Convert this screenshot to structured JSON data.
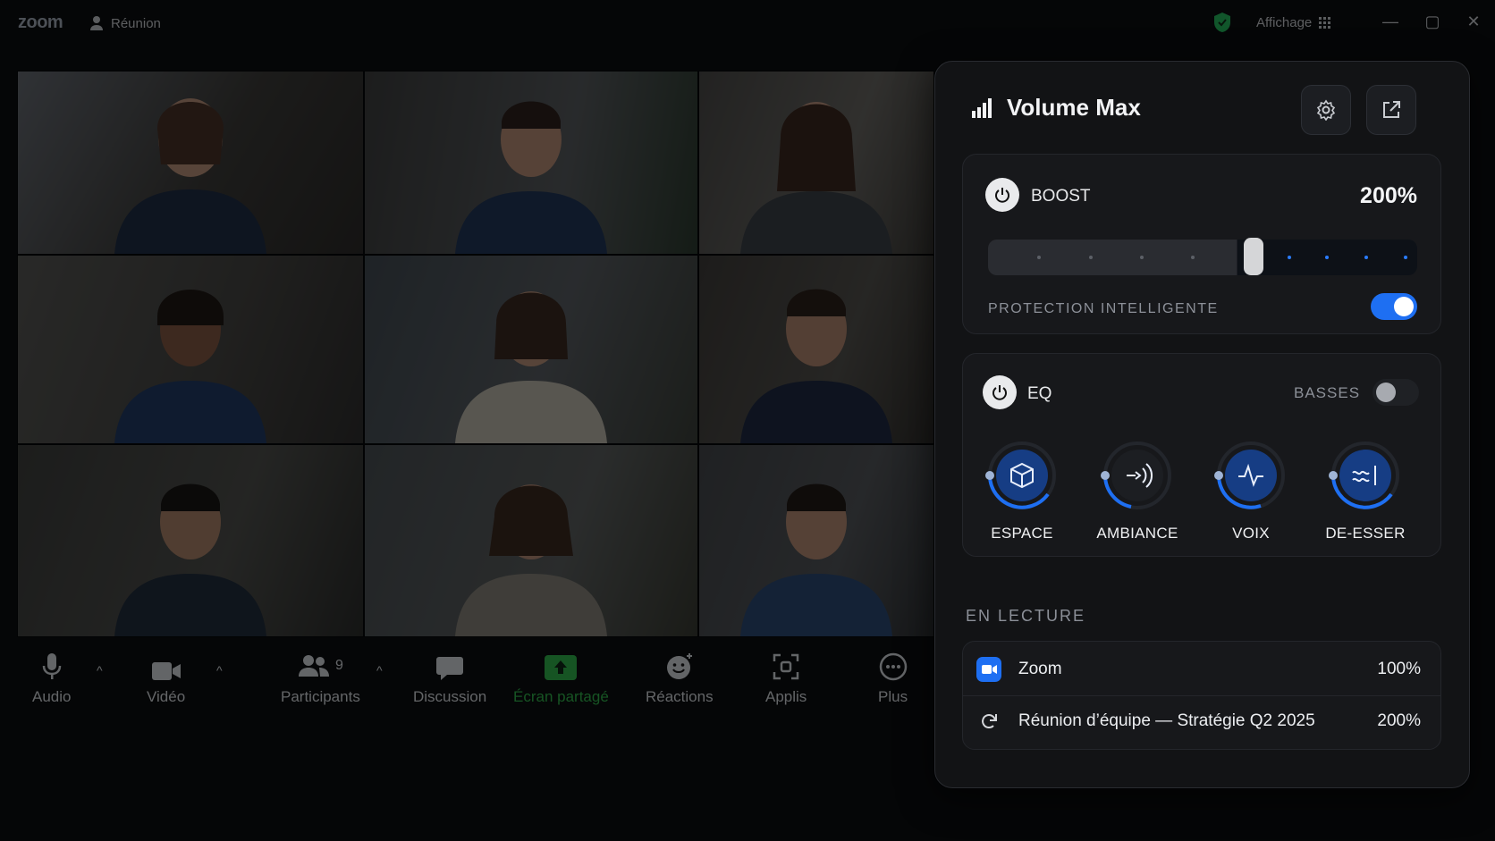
{
  "titlebar": {
    "app_logo": "zoom",
    "meeting_label": "Réunion",
    "view_label": "Affichage",
    "icons": [
      "user-icon",
      "shield-check-icon",
      "grid-icon",
      "minimize-icon",
      "maximize-icon",
      "close-icon"
    ]
  },
  "toolbar": {
    "audio": "Audio",
    "video": "Vidéo",
    "participants": "Participants",
    "participants_count": "9",
    "chat": "Discussion",
    "share": "Écran partagé",
    "reactions": "Réactions",
    "apps": "Applis",
    "more": "Plus",
    "share_color": "#2fbf4a"
  },
  "panel": {
    "title": "Volume Max",
    "boost": {
      "label": "BOOST",
      "value_text": "200%",
      "level_fraction": 0.6,
      "protection_label": "PROTECTION INTELLIGENTE",
      "protection_on": true
    },
    "eq": {
      "label": "EQ",
      "bass_label": "BASSES",
      "bass_on": false,
      "knobs": [
        {
          "label": "ESPACE",
          "icon": "cube-icon"
        },
        {
          "label": "AMBIANCE",
          "icon": "surround-icon"
        },
        {
          "label": "VOIX",
          "icon": "pulse-icon"
        },
        {
          "label": "DE-ESSER",
          "icon": "deesser-icon"
        }
      ]
    },
    "playing": {
      "label": "EN LECTURE",
      "items": [
        {
          "name": "Zoom",
          "value": "100%",
          "icon": "zoom-camera-icon"
        },
        {
          "name": "Réunion d’équipe — Stratégie Q2 2025",
          "value": "200%",
          "icon": "refresh-icon"
        }
      ]
    },
    "accent_color": "#1e6ff2"
  }
}
